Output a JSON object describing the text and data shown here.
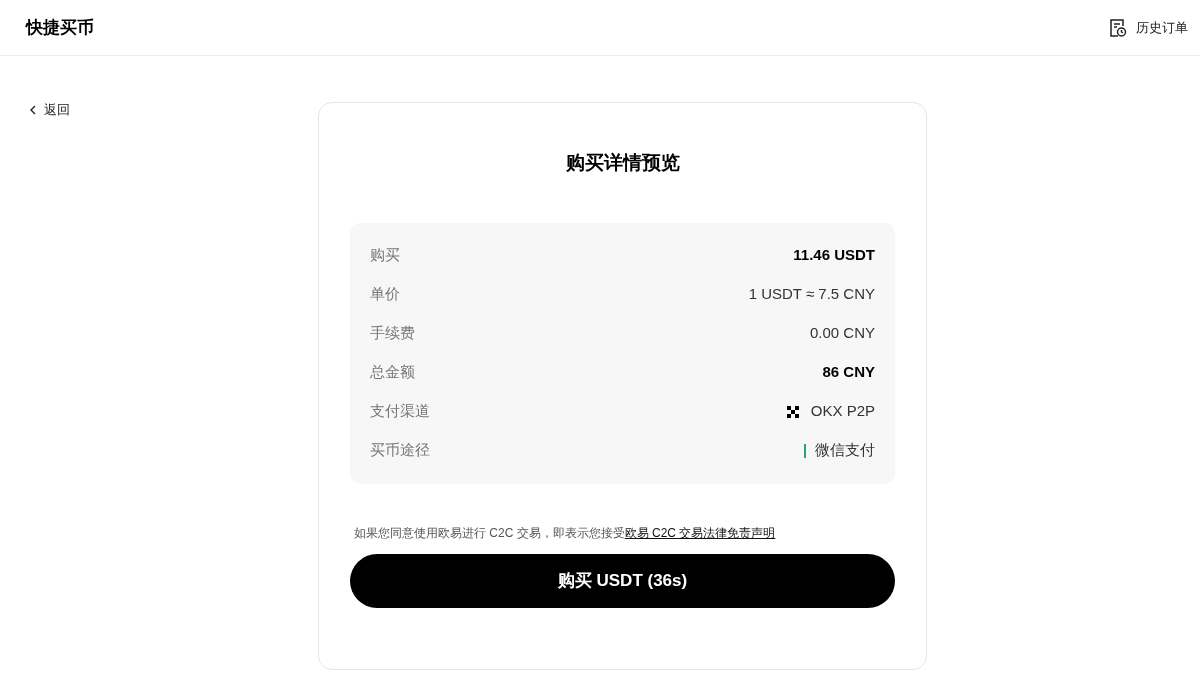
{
  "header": {
    "title": "快捷买币",
    "history_link": "历史订单"
  },
  "back": "返回",
  "card": {
    "title": "购买详情预览",
    "rows": [
      {
        "label": "购买",
        "value": "11.46 USDT",
        "kind": "strong"
      },
      {
        "label": "单价",
        "value": "1 USDT ≈ 7.5 CNY",
        "kind": "plain"
      },
      {
        "label": "手续费",
        "value": "0.00 CNY",
        "kind": "plain"
      },
      {
        "label": "总金额",
        "value": "86 CNY",
        "kind": "strong"
      },
      {
        "label": "支付渠道",
        "value": "OKX P2P",
        "kind": "logo"
      },
      {
        "label": "买币途径",
        "value": "微信支付",
        "kind": "bar"
      }
    ],
    "notice": "如果您同意使用欧易进行 C2C 交易，即表示您接受",
    "notice_link": "欧易 C2C 交易法律免责声明",
    "button": "购买 USDT (36s)"
  }
}
